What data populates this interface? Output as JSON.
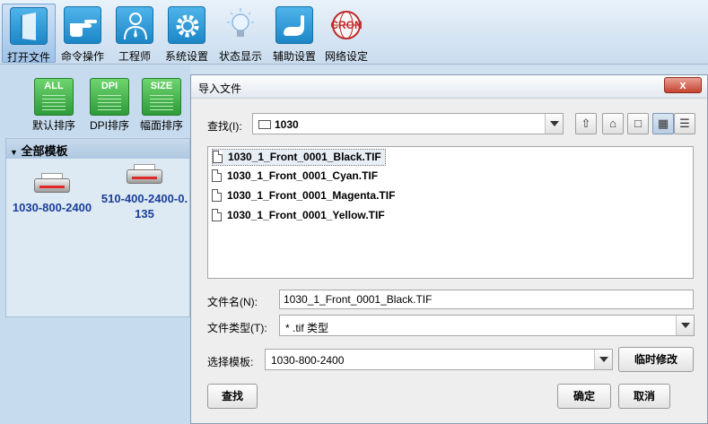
{
  "toolbar": {
    "items": [
      {
        "label": "打开文件",
        "icon": "open-file-icon"
      },
      {
        "label": "命令操作",
        "icon": "hand-pointer-icon"
      },
      {
        "label": "工程师",
        "icon": "engineer-icon"
      },
      {
        "label": "系统设置",
        "icon": "gear-icon"
      },
      {
        "label": "状态显示",
        "icon": "lightbulb-icon"
      },
      {
        "label": "辅助设置",
        "icon": "helping-hand-icon"
      },
      {
        "label": "网络设定",
        "icon": "network-globe-icon"
      }
    ],
    "network_logo_text": "CRON"
  },
  "sort_bar": {
    "items": [
      {
        "icon_text": "ALL",
        "label": "默认排序"
      },
      {
        "icon_text": "DPI",
        "label": "DPI排序"
      },
      {
        "icon_text": "SIZE",
        "label": "幅面排序"
      }
    ]
  },
  "templates": {
    "header": "全部模板",
    "items": [
      {
        "name": "1030-800-2400"
      },
      {
        "name": "510-400-2400-0.135"
      }
    ]
  },
  "dialog": {
    "title": "导入文件",
    "close_label": "x",
    "look_in_label": "查找(I):",
    "look_in_value": "1030",
    "files": [
      "1030_1_Front_0001_Black.TIF",
      "1030_1_Front_0001_Cyan.TIF",
      "1030_1_Front_0001_Magenta.TIF",
      "1030_1_Front_0001_Yellow.TIF"
    ],
    "filename_label": "文件名(N):",
    "filename_value": "1030_1_Front_0001_Black.TIF",
    "filetype_label": "文件类型(T):",
    "filetype_value": "* .tif 类型",
    "template_label": "选择模板:",
    "template_value": "1030-800-2400",
    "temp_modify_label": "临时修改",
    "find_label": "查找",
    "ok_label": "确定",
    "cancel_label": "取消"
  }
}
